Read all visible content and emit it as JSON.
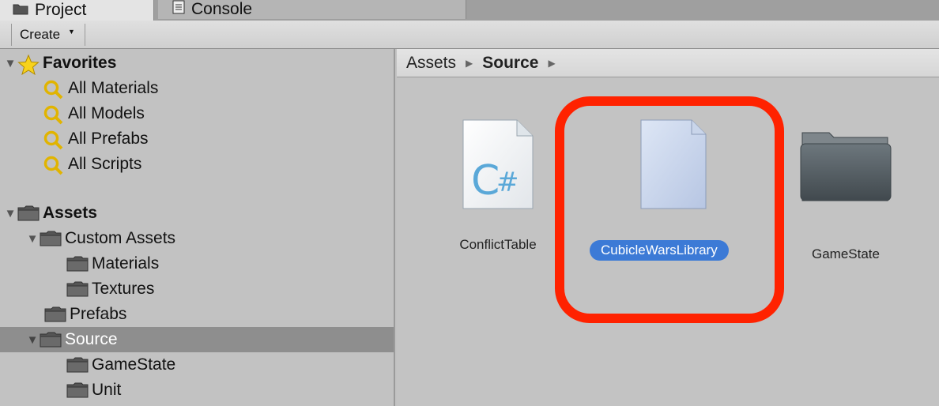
{
  "tabs": [
    {
      "label": "Project",
      "icon": "folder-icon"
    },
    {
      "label": "Console",
      "icon": "console-icon"
    }
  ],
  "toolbar": {
    "create_label": "Create"
  },
  "tree": {
    "favorites": {
      "label": "Favorites",
      "items": [
        "All Materials",
        "All Models",
        "All Prefabs",
        "All Scripts"
      ]
    },
    "assets": {
      "label": "Assets",
      "custom_assets": "Custom Assets",
      "materials": "Materials",
      "textures": "Textures",
      "prefabs": "Prefabs",
      "source": "Source",
      "gamestate": "GameState",
      "unit": "Unit"
    }
  },
  "breadcrumb": {
    "root": "Assets",
    "current": "Source"
  },
  "grid_items": [
    {
      "label": "ConflictTable",
      "icon": "csharp-script-icon"
    },
    {
      "label": "CubicleWarsLibrary",
      "icon": "file-icon",
      "selected": true
    },
    {
      "label": "GameState",
      "icon": "folder-icon"
    }
  ],
  "colors": {
    "selection": "#3c7ad6",
    "highlight": "#ff2200",
    "tree_selected": "#8e8e8e"
  }
}
